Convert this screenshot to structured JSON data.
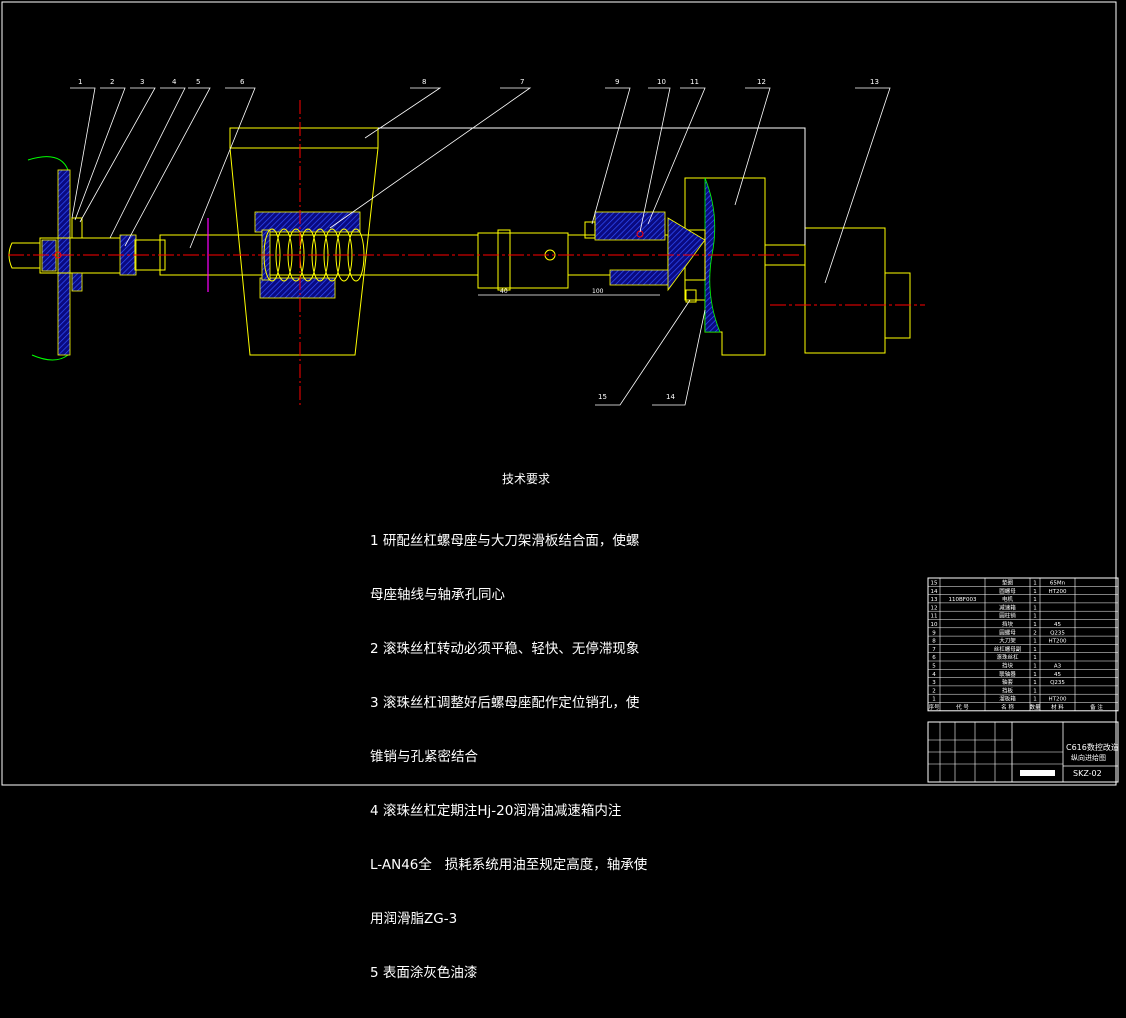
{
  "callouts": [
    "1",
    "2",
    "3",
    "4",
    "5",
    "6",
    "8",
    "7",
    "9",
    "10",
    "11",
    "12",
    "13",
    "15",
    "14"
  ],
  "dimension_text": {
    "d40": "40",
    "d100": "100"
  },
  "notes": {
    "title": "技术要求",
    "lines": [
      "1 研配丝杠螺母座与大刀架滑板结合面，使螺",
      "母座轴线与轴承孔同心",
      "2 滚珠丝杠转动必须平稳、轻快、无停滞现象",
      "3 滚珠丝杠调整好后螺母座配作定位销孔，使",
      "锥销与孔紧密结合",
      "4 滚珠丝杠定期注Hj-20润滑油减速箱内注",
      "L-AN46全   损耗系统用油至规定高度，轴承使",
      "用润滑脂ZG-3",
      "5 表面涂灰色油漆"
    ]
  },
  "parts_list": {
    "rows": [
      {
        "no": "15",
        "code": "",
        "name": "垫圈",
        "qty": "1",
        "material": "65Mn"
      },
      {
        "no": "14",
        "code": "",
        "name": "圆螺母",
        "qty": "1",
        "material": "HT200"
      },
      {
        "no": "13",
        "code": "110BF003",
        "name": "电机",
        "qty": "1",
        "material": ""
      },
      {
        "no": "12",
        "code": "",
        "name": "减速箱",
        "qty": "1",
        "material": ""
      },
      {
        "no": "11",
        "code": "",
        "name": "圆柱销",
        "qty": "1",
        "material": ""
      },
      {
        "no": "10",
        "code": "",
        "name": "挡块",
        "qty": "1",
        "material": "45"
      },
      {
        "no": "9",
        "code": "",
        "name": "圆螺母",
        "qty": "2",
        "material": "Q235"
      },
      {
        "no": "8",
        "code": "",
        "name": "大刀架",
        "qty": "1",
        "material": "HT200"
      },
      {
        "no": "7",
        "code": "",
        "name": "丝杠螺母副",
        "qty": "1",
        "material": ""
      },
      {
        "no": "6",
        "code": "",
        "name": "滚珠丝杠",
        "qty": "1",
        "material": ""
      },
      {
        "no": "5",
        "code": "",
        "name": "挡块",
        "qty": "1",
        "material": "A3"
      },
      {
        "no": "4",
        "code": "",
        "name": "联轴器",
        "qty": "1",
        "material": "45"
      },
      {
        "no": "3",
        "code": "",
        "name": "轴套",
        "qty": "1",
        "material": "Q235"
      },
      {
        "no": "2",
        "code": "",
        "name": "挡板",
        "qty": "1",
        "material": ""
      },
      {
        "no": "1",
        "code": "",
        "name": "溜板箱",
        "qty": "1",
        "material": "HT200"
      }
    ],
    "header": {
      "no": "序号",
      "code": "代 号",
      "name": "名 称",
      "qty": "数量",
      "material": "材 料",
      "remark": "备 注"
    }
  },
  "title_block": {
    "title_line1": "C616数控改造",
    "title_line2": "纵向进给图",
    "drawing_no": "SKZ-02"
  },
  "colors": {
    "outline": "#ffff00",
    "hatch": "#0000ff",
    "center": "#ff0000",
    "leader": "#ffffff",
    "spring": "#00ff00",
    "section": "#ff00ff"
  }
}
